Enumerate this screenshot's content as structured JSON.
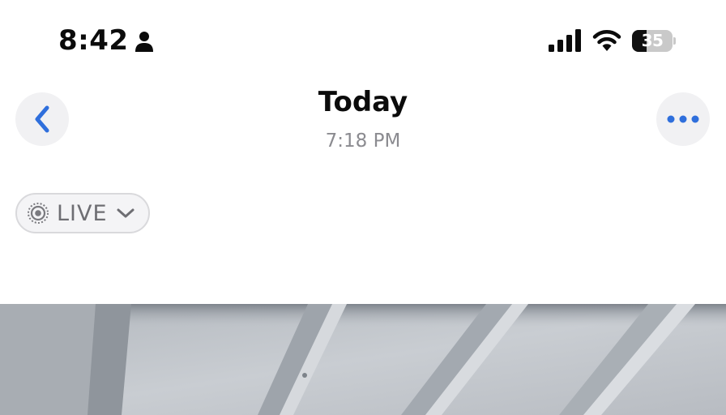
{
  "status_bar": {
    "time": "8:42",
    "battery_level": "35",
    "battery_fraction": 0.35
  },
  "nav": {
    "title": "Today",
    "subtitle": "7:18 PM"
  },
  "live_badge": {
    "label": "LIVE"
  },
  "icons": {
    "person": "person-icon",
    "signal": "cellular-signal-icon",
    "wifi": "wifi-icon",
    "back": "chevron-left-icon",
    "more": "ellipsis-icon",
    "live": "live-photo-icon",
    "dropdown": "chevron-down-icon"
  },
  "colors": {
    "accent": "#2f6fdc",
    "secondary_text": "#8b8b90",
    "button_bg": "#f1f1f3"
  }
}
